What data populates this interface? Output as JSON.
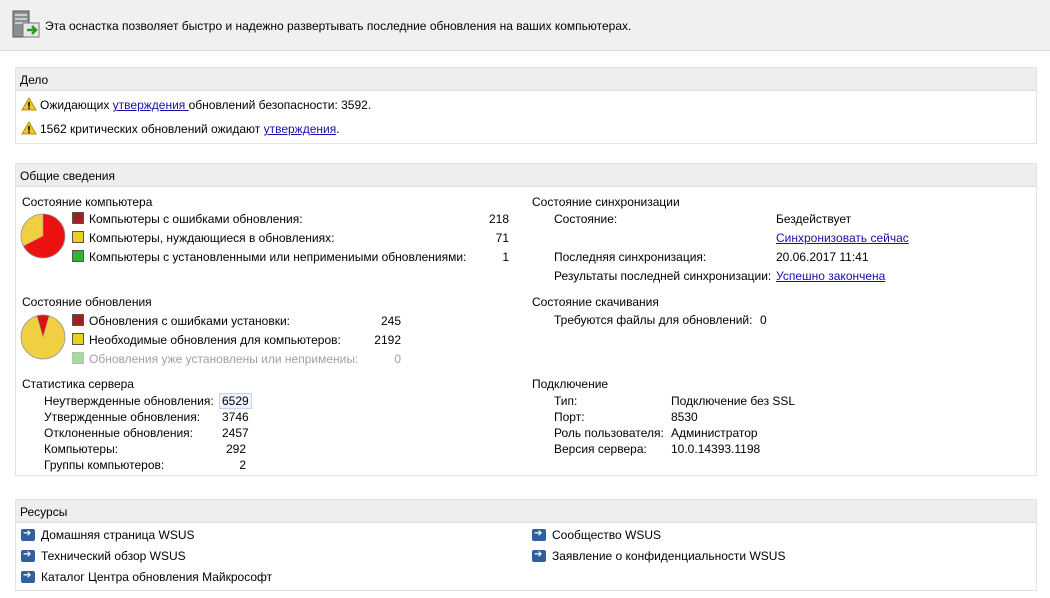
{
  "header": {
    "description": "Эта оснастка позволяет быстро и надежно развертывать последние обновления на ваших компьютерах."
  },
  "tasks": {
    "title": "Дело",
    "items": [
      {
        "before": "Ожидающих ",
        "link": "утверждения ",
        "after": "обновлений безопасности: 3592."
      },
      {
        "before": "1562 критических обновлений ожидают ",
        "link": "утверждения",
        "after": "."
      }
    ]
  },
  "overview": {
    "title": "Общие сведения",
    "computer_status": {
      "title": "Состояние компьютера",
      "rows": [
        {
          "label": "Компьютеры с ошибками обновления:",
          "value": "218",
          "color": "red"
        },
        {
          "label": "Компьютеры, нуждающиеся в обновлениях:",
          "value": "71",
          "color": "yellow"
        },
        {
          "label": "Компьютеры с установленными или непримениыми обновлениями:",
          "value": "1",
          "color": "green"
        }
      ]
    },
    "sync_status": {
      "title": "Состояние синхронизации",
      "state_label": "Состояние:",
      "state_value": "Бездействует",
      "sync_now_link": "Синхронизовать сейчас",
      "last_sync_label": "Последняя синхронизация:",
      "last_sync_value": "20.06.2017 11:41",
      "last_result_label": "Результаты последней синхронизации:",
      "last_result_link": "Успешно закончена"
    },
    "update_status": {
      "title": "Состояние обновления",
      "rows": [
        {
          "label": "Обновления с ошибками установки:",
          "value": "245",
          "color": "red"
        },
        {
          "label": "Необходимые обновления для компьютеров:",
          "value": "2192",
          "color": "yellow"
        },
        {
          "label": "Обновления уже установлены или непримениы:",
          "value": "0",
          "color": "lightgreen"
        }
      ]
    },
    "download_status": {
      "title": "Состояние скачивания",
      "files_label": "Требуются файлы для обновлений:",
      "files_value": "0"
    },
    "server_stats": {
      "title": "Статистика сервера",
      "rows": [
        {
          "label": "Неутвержденные обновления:",
          "value": "6529"
        },
        {
          "label": "Утвержденные обновления:",
          "value": "3746"
        },
        {
          "label": "Отклоненные обновления:",
          "value": "2457"
        },
        {
          "label": "Компьютеры:",
          "value": "292"
        },
        {
          "label": "Группы компьютеров:",
          "value": "2"
        }
      ]
    },
    "connection": {
      "title": "Подключение",
      "rows": [
        {
          "label": "Тип:",
          "value": "Подключение без SSL"
        },
        {
          "label": "Порт:",
          "value": "8530"
        },
        {
          "label": "Роль пользователя:",
          "value": "Администратор"
        },
        {
          "label": "Версия сервера:",
          "value": "10.0.14393.1198"
        }
      ]
    }
  },
  "resources": {
    "title": "Ресурсы",
    "links": [
      "Домашняя страница WSUS",
      "Технический обзор WSUS",
      "Каталог Центра обновления Майкрософт",
      "Сообщество WSUS",
      "Заявление о конфиденциальности WSUS"
    ]
  },
  "colors": {
    "red": "#a01f1f",
    "yellow": "#e8d21c",
    "green": "#33b233",
    "link": "#1a0dab"
  }
}
